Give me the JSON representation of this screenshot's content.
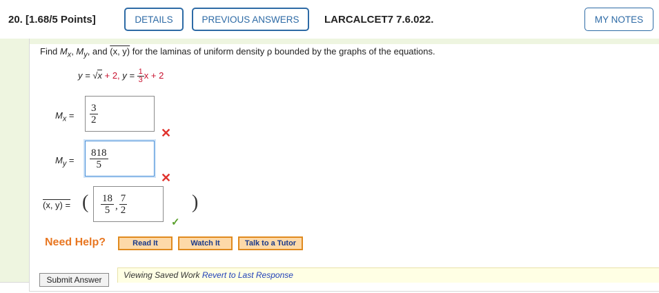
{
  "header": {
    "question_number": "20.",
    "points": "[1.68/5 Points]",
    "details_label": "DETAILS",
    "previous_answers_label": "PREVIOUS ANSWERS",
    "reference": "LARCALCET7 7.6.022.",
    "my_notes_label": "MY NOTES"
  },
  "problem": {
    "prompt_find": "Find",
    "prompt_mx": "M",
    "prompt_mx_sub": "x",
    "prompt_my": "M",
    "prompt_my_sub": "y",
    "prompt_and": "and",
    "prompt_xbar": "(x, y)",
    "prompt_rest": "for the laminas of uniform density ρ bounded by the graphs of the equations.",
    "eq_y1": "y =",
    "eq_sqrt_arg": "x",
    "eq_plus2": "+ 2,",
    "eq_y2": "y =",
    "eq_frac_num": "1",
    "eq_frac_den": "3",
    "eq_tail": "x + 2"
  },
  "answers": {
    "mx_label": "M",
    "mx_sub": "x",
    "equals": "=",
    "mx_num": "3",
    "mx_den": "2",
    "mx_status": "incorrect",
    "my_label": "M",
    "my_sub": "y",
    "my_num": "818",
    "my_den": "5",
    "my_status": "incorrect",
    "centroid_label": "(x, y) =",
    "cx_num": "18",
    "cx_den": "5",
    "comma": ",",
    "cy_num": "7",
    "cy_den": "2",
    "centroid_status": "correct"
  },
  "help": {
    "need_help": "Need Help?",
    "read_it": "Read It",
    "watch_it": "Watch It",
    "talk_to_tutor": "Talk to a Tutor"
  },
  "footer": {
    "submit_label": "Submit Answer",
    "saved_text": "Viewing Saved Work",
    "revert_link": "Revert to Last Response"
  },
  "colors": {
    "accent_blue": "#2d6aa5",
    "incorrect_red": "#e0322c",
    "correct_green": "#5aa02c",
    "help_orange": "#e87722",
    "saved_bg": "#ffffe4"
  }
}
